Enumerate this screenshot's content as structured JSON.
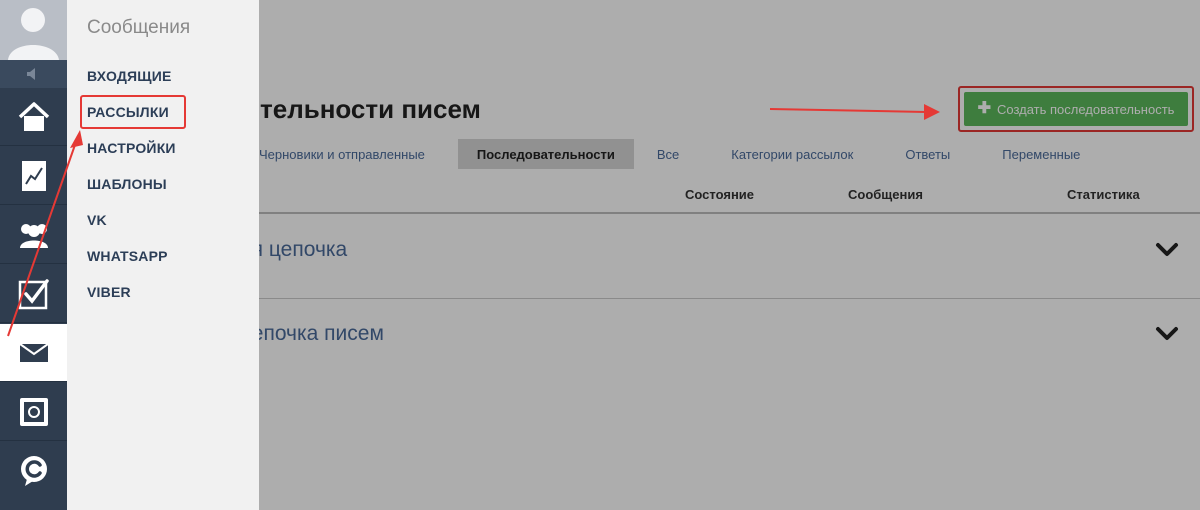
{
  "main": {
    "page_title_partial": "е",
    "section_title": "тельности писем",
    "create_button": {
      "icon": "plus-icon",
      "label": "Создать последовательность"
    },
    "tabs": [
      {
        "label": "Черновики и отправленные",
        "active": false
      },
      {
        "label": "Последовательности",
        "active": true
      },
      {
        "label": "Все",
        "active": false
      },
      {
        "label": "Категории рассылок",
        "active": false
      },
      {
        "label": "Ответы",
        "active": false
      },
      {
        "label": "Переменные",
        "active": false
      }
    ],
    "columns": [
      "Состояние",
      "Сообщения",
      "Статистика"
    ],
    "rows": [
      {
        "title": "ая цепочка"
      },
      {
        "title": "цепочка писем"
      }
    ]
  },
  "rail": {
    "items": [
      {
        "icon": "home-icon"
      },
      {
        "icon": "chart-icon"
      },
      {
        "icon": "users-icon"
      },
      {
        "icon": "checkbox-icon"
      },
      {
        "icon": "mail-icon",
        "active": true
      },
      {
        "icon": "safe-icon"
      },
      {
        "icon": "chat-logo-icon"
      }
    ]
  },
  "submenu": {
    "title": "Сообщения",
    "items": [
      {
        "label": "ВХОДЯЩИЕ"
      },
      {
        "label": "РАССЫЛКИ",
        "highlighted": true
      },
      {
        "label": "НАСТРОЙКИ"
      },
      {
        "label": "ШАБЛОНЫ"
      },
      {
        "label": "VK"
      },
      {
        "label": "WHATSAPP"
      },
      {
        "label": "VIBER"
      }
    ]
  },
  "colors": {
    "rail_bg": "#2f3d4f",
    "submenu_bg": "#f1f1f1",
    "accent_green": "#5cb85c",
    "annotation_red": "#e53935",
    "link_blue": "#4a6a9a"
  }
}
